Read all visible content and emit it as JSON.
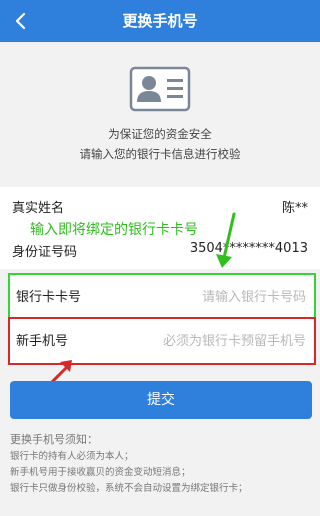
{
  "header": {
    "title": "更换手机号",
    "back_icon": "chevron-left-icon"
  },
  "hero": {
    "icon": "id-card-icon",
    "notice_line1": "为保证您的资金安全",
    "notice_line2": "请输入您的银行卡信息进行校验"
  },
  "info": {
    "name_label": "真实姓名",
    "name_value": "陈**",
    "id_label": "身份证号码",
    "id_value": "3504********4013"
  },
  "annotation": {
    "text": "输入即将绑定的银行卡卡号",
    "color": "#2fbf1f"
  },
  "form": {
    "card_label": "银行卡卡号",
    "card_placeholder": "请输入银行卡号码",
    "phone_label": "新手机号",
    "phone_placeholder": "必须为银行卡预留手机号"
  },
  "submit": {
    "label": "提交"
  },
  "tips": {
    "title": "更换手机号须知：",
    "line1": "银行卡的持有人必须为本人；",
    "line2": "新手机号用于接收赢贝的资金变动短消息；",
    "line3": "银行卡只做身份校验，系统不会自动设置为绑定银行卡；"
  },
  "colors": {
    "brand": "#2f7fdc",
    "highlight_green": "#36d436",
    "highlight_red": "#d62828"
  }
}
